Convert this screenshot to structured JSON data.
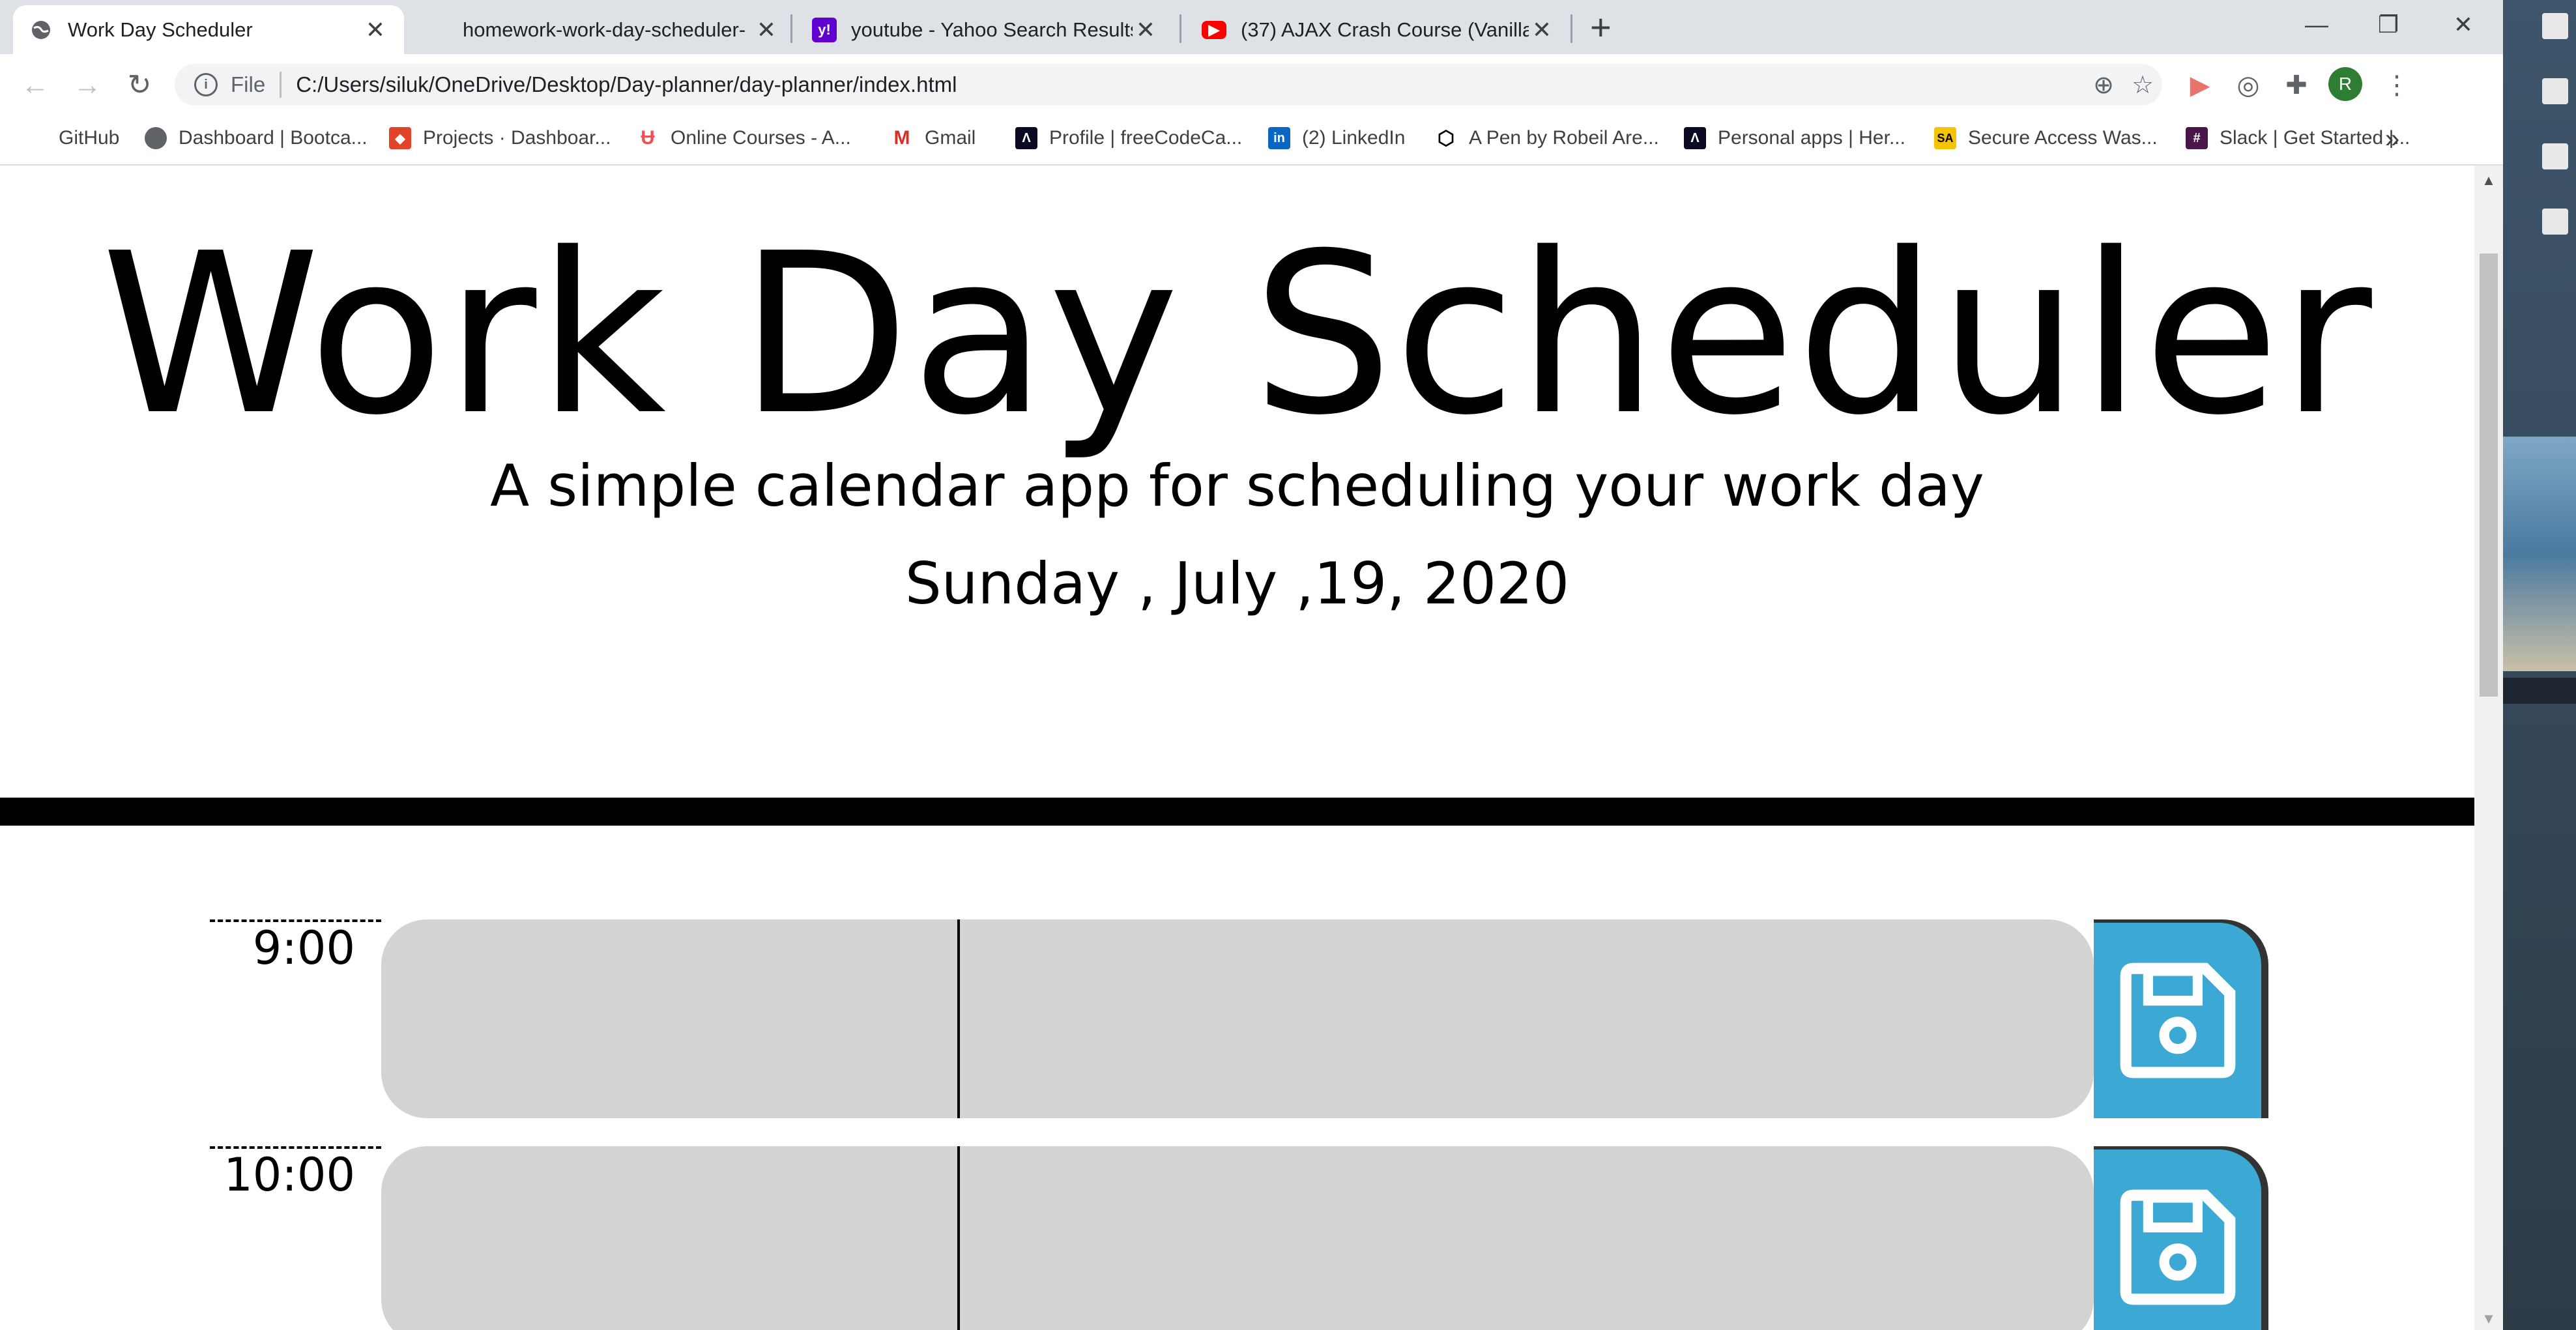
{
  "browser": {
    "tabs": [
      {
        "title": "Work Day Scheduler",
        "active": true,
        "icon": "globe-icon"
      },
      {
        "title": "homework-work-day-scheduler-",
        "active": false,
        "icon": "none"
      },
      {
        "title": "youtube - Yahoo Search Results",
        "active": false,
        "icon": "yahoo-icon"
      },
      {
        "title": "(37) AJAX Crash Course (Vanilla J",
        "active": false,
        "icon": "youtube-icon"
      }
    ],
    "new_tab_label": "+",
    "window_controls": {
      "minimize": "—",
      "restore": "❐",
      "close": "✕"
    },
    "address": {
      "scheme_label": "File",
      "url": "C:/Users/siluk/OneDrive/Desktop/Day-planner/day-planner/index.html"
    },
    "profile_initial": "R",
    "bookmarks": [
      {
        "label": "GitHub",
        "icon": "none"
      },
      {
        "label": "Dashboard | Bootca...",
        "icon": "globe-icon"
      },
      {
        "label": "Projects · Dashboar...",
        "icon": "gitlab-icon"
      },
      {
        "label": "Online Courses - A...",
        "icon": "udemy-icon"
      },
      {
        "label": "Gmail",
        "icon": "gmail-icon"
      },
      {
        "label": "Profile | freeCodeCa...",
        "icon": "freecodecamp-icon"
      },
      {
        "label": "(2) LinkedIn",
        "icon": "linkedin-icon"
      },
      {
        "label": "A Pen by Robeil Are...",
        "icon": "codepen-icon"
      },
      {
        "label": "Personal apps | Her...",
        "icon": "heroku-icon"
      },
      {
        "label": "Secure Access Was...",
        "icon": "sa-icon"
      },
      {
        "label": "Slack | Get Started |...",
        "icon": "slack-icon"
      }
    ],
    "bookmarks_more": "»"
  },
  "page": {
    "title": "Work Day Scheduler",
    "lead": "A simple calendar app for scheduling your work day",
    "current_day": "Sunday , July ,19, 2020",
    "timeblocks": [
      {
        "hour": "9:00",
        "text": ""
      },
      {
        "hour": "10:00",
        "text": ""
      }
    ]
  },
  "colors": {
    "past": "#d3d3d3",
    "save_button": "#3ba9d4"
  }
}
